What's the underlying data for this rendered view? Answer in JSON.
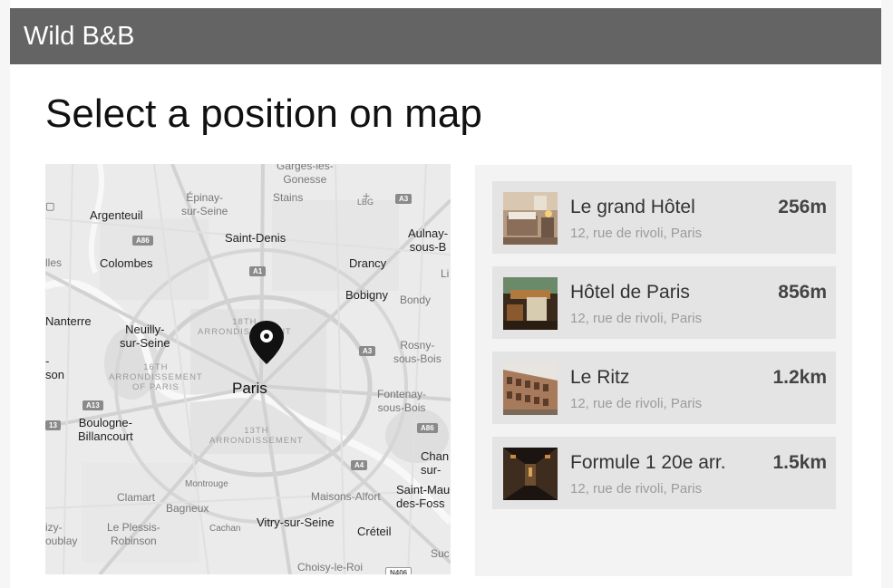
{
  "app": {
    "title": "Wild B&B"
  },
  "page": {
    "title": "Select a position on map"
  },
  "map": {
    "labels": {
      "garges": "Garges-lès-\nGonesse",
      "epinay": "Épinay-\nsur-Seine",
      "stains": "Stains",
      "lbg": "LBG",
      "argenteuil": "Argenteuil",
      "aulnay": "Aulnay-\nsous-B",
      "saint_denis": "Saint-Denis",
      "colombes": "Colombes",
      "drancy": "Drancy",
      "lles": "lles",
      "li": "Li",
      "bobigny": "Bobigny",
      "bondy": "Bondy",
      "nanterre": "Nanterre",
      "neuilly": "Neuilly-\nsur-Seine",
      "arr18": "18TH\nARRONDISSEMENT",
      "rosny": "Rosny-\nsous-Bois",
      "son": "-\nson",
      "arr16": "16TH\nARRONDISSEMENT\nOF PARIS",
      "paris": "Paris",
      "fontenay": "Fontenay-\nsous-Bois",
      "boulogne": "Boulogne-\nBillancourt",
      "arr13": "13TH\nARRONDISSEMENT",
      "chan": "Chan\nsur-",
      "montrouge": "Montrouge",
      "clamart": "Clamart",
      "bagneux": "Bagneux",
      "maisons_alfort": "Maisons-Alfort",
      "saint_maur": "Saint-Mau\ndes-Foss",
      "izy": "izy-\noublay",
      "plessis": "Le Plessis-\nRobinson",
      "cachan": "Cachan",
      "vitry": "Vitry-sur-Seine",
      "creteil": "Créteil",
      "suc": "Suc",
      "choisy": "Choisy-le-Roi"
    },
    "roads": {
      "a3_top": "A3",
      "a86_left": "A86",
      "a1": "A1",
      "a3_mid": "A3",
      "a13": "A13",
      "r13": "13",
      "a86_right": "A86",
      "a4": "A4",
      "n406": "N406"
    }
  },
  "hotels": [
    {
      "name": "Le grand Hôtel",
      "address": "12, rue de rivoli, Paris",
      "distance": "256m"
    },
    {
      "name": "Hôtel de Paris",
      "address": "12, rue de rivoli, Paris",
      "distance": "856m"
    },
    {
      "name": "Le Ritz",
      "address": "12, rue de rivoli, Paris",
      "distance": "1.2km"
    },
    {
      "name": "Formule 1 20e arr.",
      "address": "12, rue de rivoli, Paris",
      "distance": "1.5km"
    }
  ]
}
